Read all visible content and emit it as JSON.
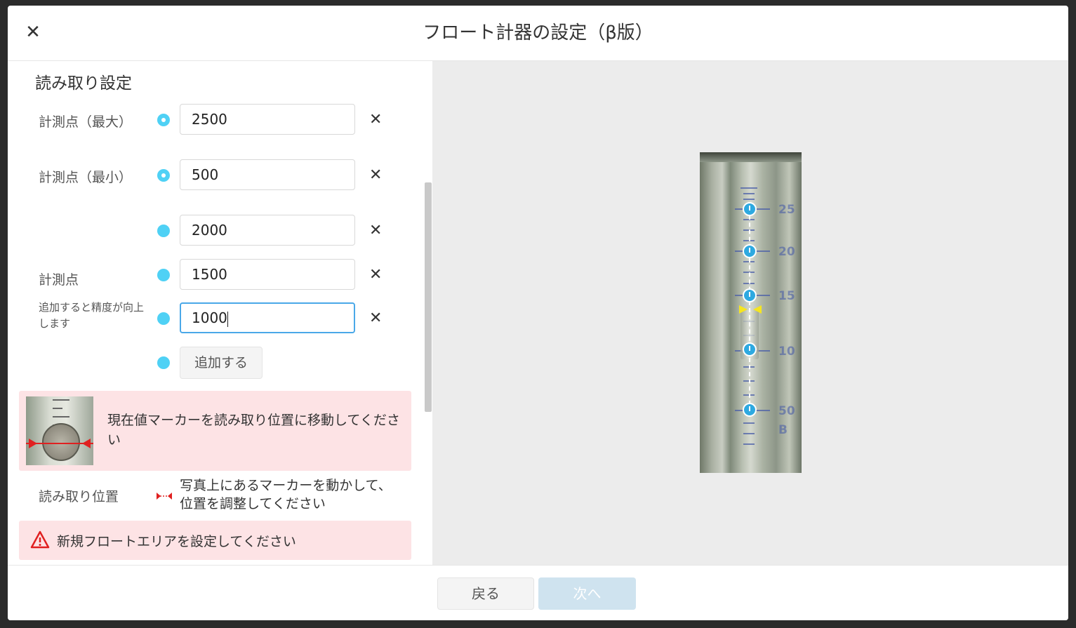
{
  "header": {
    "title": "フロート計器の設定（β版）"
  },
  "reading": {
    "section_title": "読み取り設定",
    "max_label": "計測点（最大）",
    "max_value": "2500",
    "min_label": "計測点（最小）",
    "min_value": "500",
    "points_label": "計測点",
    "points_hint": "追加すると精度が向上します",
    "points": [
      "2000",
      "1500",
      "1000"
    ],
    "add_button": "追加する"
  },
  "marker_alert": {
    "text": "現在値マーカーを読み取り位置に移動してください"
  },
  "read_position": {
    "label": "読み取り位置",
    "text": "写真上にあるマーカーを動かして、位置を調整してください"
  },
  "area_alert": {
    "text": "新規フロートエリアを設定してください"
  },
  "footer": {
    "back": "戻る",
    "next": "次へ"
  },
  "colors": {
    "accent": "#4fd1f5",
    "alert_bg": "#fde3e5",
    "warning": "#e02020",
    "disabled_button": "#cfe3ef"
  }
}
